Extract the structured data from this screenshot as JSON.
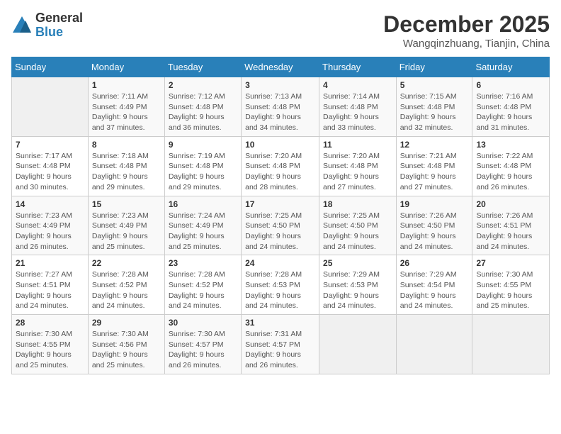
{
  "logo": {
    "general": "General",
    "blue": "Blue"
  },
  "header": {
    "month": "December 2025",
    "location": "Wangqinzhuang, Tianjin, China"
  },
  "weekdays": [
    "Sunday",
    "Monday",
    "Tuesday",
    "Wednesday",
    "Thursday",
    "Friday",
    "Saturday"
  ],
  "weeks": [
    [
      {
        "day": "",
        "info": ""
      },
      {
        "day": "1",
        "info": "Sunrise: 7:11 AM\nSunset: 4:49 PM\nDaylight: 9 hours\nand 37 minutes."
      },
      {
        "day": "2",
        "info": "Sunrise: 7:12 AM\nSunset: 4:48 PM\nDaylight: 9 hours\nand 36 minutes."
      },
      {
        "day": "3",
        "info": "Sunrise: 7:13 AM\nSunset: 4:48 PM\nDaylight: 9 hours\nand 34 minutes."
      },
      {
        "day": "4",
        "info": "Sunrise: 7:14 AM\nSunset: 4:48 PM\nDaylight: 9 hours\nand 33 minutes."
      },
      {
        "day": "5",
        "info": "Sunrise: 7:15 AM\nSunset: 4:48 PM\nDaylight: 9 hours\nand 32 minutes."
      },
      {
        "day": "6",
        "info": "Sunrise: 7:16 AM\nSunset: 4:48 PM\nDaylight: 9 hours\nand 31 minutes."
      }
    ],
    [
      {
        "day": "7",
        "info": "Sunrise: 7:17 AM\nSunset: 4:48 PM\nDaylight: 9 hours\nand 30 minutes."
      },
      {
        "day": "8",
        "info": "Sunrise: 7:18 AM\nSunset: 4:48 PM\nDaylight: 9 hours\nand 29 minutes."
      },
      {
        "day": "9",
        "info": "Sunrise: 7:19 AM\nSunset: 4:48 PM\nDaylight: 9 hours\nand 29 minutes."
      },
      {
        "day": "10",
        "info": "Sunrise: 7:20 AM\nSunset: 4:48 PM\nDaylight: 9 hours\nand 28 minutes."
      },
      {
        "day": "11",
        "info": "Sunrise: 7:20 AM\nSunset: 4:48 PM\nDaylight: 9 hours\nand 27 minutes."
      },
      {
        "day": "12",
        "info": "Sunrise: 7:21 AM\nSunset: 4:48 PM\nDaylight: 9 hours\nand 27 minutes."
      },
      {
        "day": "13",
        "info": "Sunrise: 7:22 AM\nSunset: 4:48 PM\nDaylight: 9 hours\nand 26 minutes."
      }
    ],
    [
      {
        "day": "14",
        "info": "Sunrise: 7:23 AM\nSunset: 4:49 PM\nDaylight: 9 hours\nand 26 minutes."
      },
      {
        "day": "15",
        "info": "Sunrise: 7:23 AM\nSunset: 4:49 PM\nDaylight: 9 hours\nand 25 minutes."
      },
      {
        "day": "16",
        "info": "Sunrise: 7:24 AM\nSunset: 4:49 PM\nDaylight: 9 hours\nand 25 minutes."
      },
      {
        "day": "17",
        "info": "Sunrise: 7:25 AM\nSunset: 4:50 PM\nDaylight: 9 hours\nand 24 minutes."
      },
      {
        "day": "18",
        "info": "Sunrise: 7:25 AM\nSunset: 4:50 PM\nDaylight: 9 hours\nand 24 minutes."
      },
      {
        "day": "19",
        "info": "Sunrise: 7:26 AM\nSunset: 4:50 PM\nDaylight: 9 hours\nand 24 minutes."
      },
      {
        "day": "20",
        "info": "Sunrise: 7:26 AM\nSunset: 4:51 PM\nDaylight: 9 hours\nand 24 minutes."
      }
    ],
    [
      {
        "day": "21",
        "info": "Sunrise: 7:27 AM\nSunset: 4:51 PM\nDaylight: 9 hours\nand 24 minutes."
      },
      {
        "day": "22",
        "info": "Sunrise: 7:28 AM\nSunset: 4:52 PM\nDaylight: 9 hours\nand 24 minutes."
      },
      {
        "day": "23",
        "info": "Sunrise: 7:28 AM\nSunset: 4:52 PM\nDaylight: 9 hours\nand 24 minutes."
      },
      {
        "day": "24",
        "info": "Sunrise: 7:28 AM\nSunset: 4:53 PM\nDaylight: 9 hours\nand 24 minutes."
      },
      {
        "day": "25",
        "info": "Sunrise: 7:29 AM\nSunset: 4:53 PM\nDaylight: 9 hours\nand 24 minutes."
      },
      {
        "day": "26",
        "info": "Sunrise: 7:29 AM\nSunset: 4:54 PM\nDaylight: 9 hours\nand 24 minutes."
      },
      {
        "day": "27",
        "info": "Sunrise: 7:30 AM\nSunset: 4:55 PM\nDaylight: 9 hours\nand 25 minutes."
      }
    ],
    [
      {
        "day": "28",
        "info": "Sunrise: 7:30 AM\nSunset: 4:55 PM\nDaylight: 9 hours\nand 25 minutes."
      },
      {
        "day": "29",
        "info": "Sunrise: 7:30 AM\nSunset: 4:56 PM\nDaylight: 9 hours\nand 25 minutes."
      },
      {
        "day": "30",
        "info": "Sunrise: 7:30 AM\nSunset: 4:57 PM\nDaylight: 9 hours\nand 26 minutes."
      },
      {
        "day": "31",
        "info": "Sunrise: 7:31 AM\nSunset: 4:57 PM\nDaylight: 9 hours\nand 26 minutes."
      },
      {
        "day": "",
        "info": ""
      },
      {
        "day": "",
        "info": ""
      },
      {
        "day": "",
        "info": ""
      }
    ]
  ]
}
